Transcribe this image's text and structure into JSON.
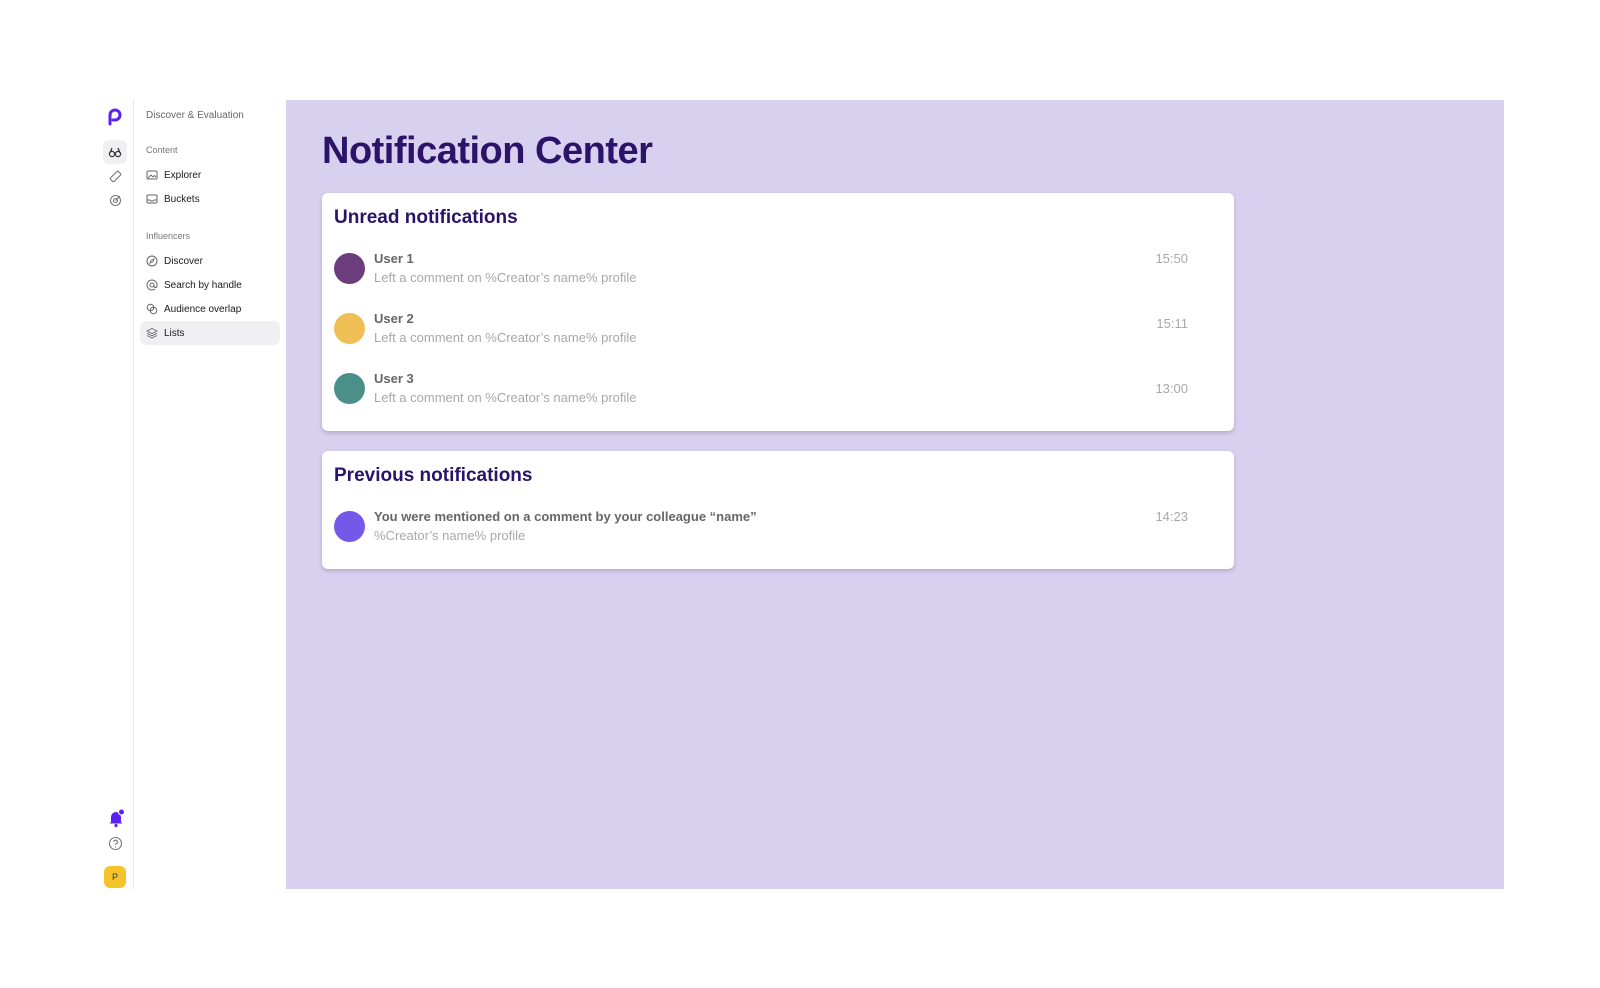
{
  "sidebar": {
    "section_title": "Discover & Evaluation",
    "groups": [
      {
        "label": "Content",
        "items": [
          {
            "label": "Explorer",
            "icon": "image-icon"
          },
          {
            "label": "Buckets",
            "icon": "inbox-icon"
          }
        ]
      },
      {
        "label": "Influencers",
        "items": [
          {
            "label": "Discover",
            "icon": "compass-icon"
          },
          {
            "label": "Search by handle",
            "icon": "at-icon"
          },
          {
            "label": "Audience overlap",
            "icon": "overlap-icon"
          },
          {
            "label": "Lists",
            "icon": "layers-icon",
            "active": true
          }
        ]
      }
    ],
    "avatar_initial": "P"
  },
  "main": {
    "title": "Notification Center",
    "unread": {
      "title": "Unread notifications",
      "items": [
        {
          "user": "User 1",
          "message": "Left a comment on %Creator’s name% profile",
          "time": "15:50",
          "color": "#6b3d7d"
        },
        {
          "user": "User 2",
          "message": "Left a comment on %Creator’s name% profile",
          "time": "15:11",
          "color": "#efbf56"
        },
        {
          "user": "User 3",
          "message": "Left a comment on %Creator’s name% profile",
          "time": "13:00",
          "color": "#4a9089"
        }
      ]
    },
    "previous": {
      "title": "Previous notifications",
      "items": [
        {
          "user": "You were mentioned on a comment by your colleague “name”",
          "message": "%Creator’s name% profile",
          "time": "14:23",
          "color": "#7459e8"
        }
      ]
    }
  },
  "colors": {
    "accent": "#5b21f0",
    "main_bg": "#d8d0ef",
    "title": "#2a1369"
  }
}
